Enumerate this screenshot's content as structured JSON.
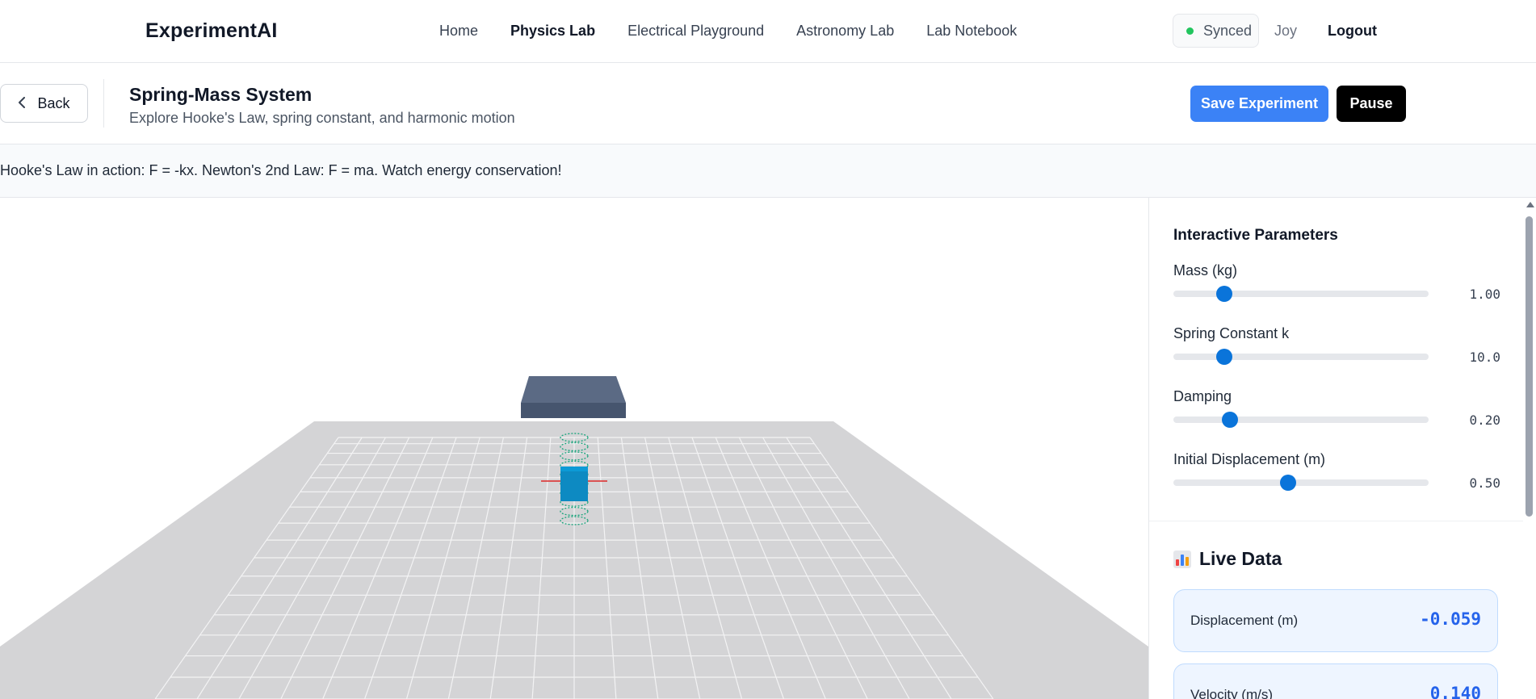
{
  "nav": {
    "brand": "ExperimentAI",
    "links": [
      {
        "label": "Home",
        "active": false
      },
      {
        "label": "Physics Lab",
        "active": true
      },
      {
        "label": "Electrical Playground",
        "active": false
      },
      {
        "label": "Astronomy Lab",
        "active": false
      },
      {
        "label": "Lab Notebook",
        "active": false
      }
    ],
    "sync_status": "Synced",
    "sync_color": "#22c55e",
    "user": "Joy",
    "logout": "Logout"
  },
  "header": {
    "back_label": "Back",
    "back_icon": "chevron-left-icon",
    "title": "Spring-Mass System",
    "subtitle": "Explore Hooke's Law, spring constant, and harmonic motion",
    "save_label": "Save Experiment",
    "pause_label": "Pause",
    "save_color": "#3b82f6"
  },
  "info": {
    "text": "Hooke's Law in action: F = -kx. Newton's 2nd Law: F = ma. Watch energy conservation!"
  },
  "parameters": {
    "title": "Interactive Parameters",
    "items": [
      {
        "label": "Mass (kg)",
        "value": "1.00",
        "fraction": 0.2
      },
      {
        "label": "Spring Constant k",
        "value": "10.0",
        "fraction": 0.2
      },
      {
        "label": "Damping",
        "value": "0.20",
        "fraction": 0.22
      },
      {
        "label": "Initial Displacement (m)",
        "value": "0.50",
        "fraction": 0.45
      }
    ],
    "accent": "#0a74da"
  },
  "live_data": {
    "title": "Live Data",
    "icon": "bar-chart-icon",
    "cards": [
      {
        "label": "Displacement (m)",
        "value": "-0.059"
      },
      {
        "label": "Velocity (m/s)",
        "value": "0.140"
      }
    ]
  }
}
